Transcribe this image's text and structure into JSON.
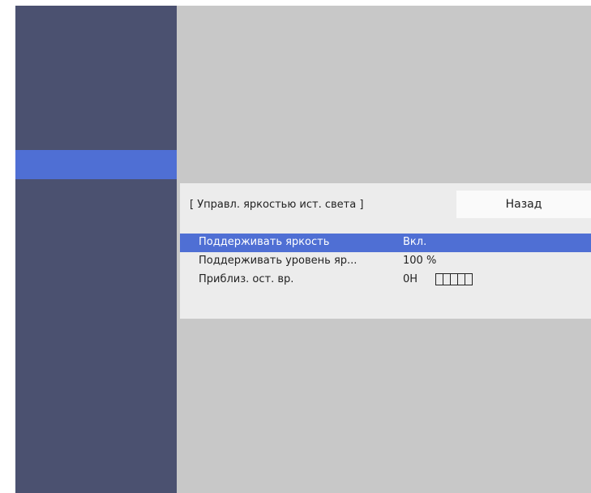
{
  "panel": {
    "title": "[ Управл. яркостью ист. света ]",
    "back_label": "Назад"
  },
  "menu": {
    "items": [
      {
        "label": "Поддерживать яркость",
        "value": "Вкл.",
        "selected": true
      },
      {
        "label": "Поддерживать уровень яр...",
        "value": "100 %"
      },
      {
        "label": "Приблиз. ост. вр.",
        "value": "0H",
        "gauge_segments": 5
      }
    ]
  },
  "colors": {
    "screen_bg": "#c8c8c8",
    "sidebar_bg": "#4b5170",
    "accent": "#4f6fd4",
    "panel_bg": "#ececec"
  }
}
